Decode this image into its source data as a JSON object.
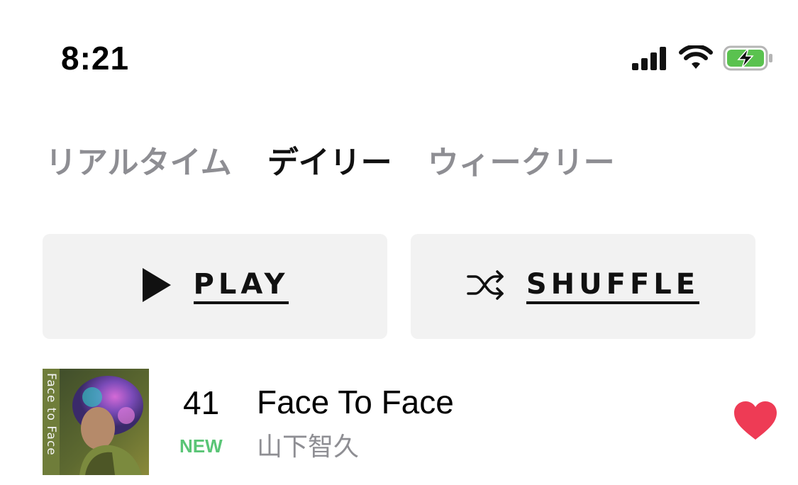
{
  "status_bar": {
    "time": "8:21",
    "icons": [
      "cellular-signal-icon",
      "wifi-icon",
      "battery-charging-icon"
    ],
    "battery_color": "#5ac24f"
  },
  "tabs": [
    {
      "label": "リアルタイム",
      "active": false
    },
    {
      "label": "デイリー",
      "active": true
    },
    {
      "label": "ウィークリー",
      "active": false
    }
  ],
  "actions": {
    "play_label": "PLAY",
    "play_icon": "play-icon",
    "shuffle_label": "SHUFFLE",
    "shuffle_icon": "shuffle-icon"
  },
  "tracks": [
    {
      "rank": "41",
      "badge": "NEW",
      "title": "Face To Face",
      "artist": "山下智久",
      "artwork_text": "Face to Face",
      "liked": true,
      "like_icon": "heart-icon"
    }
  ],
  "colors": {
    "accent_new": "#5ac576",
    "heart": "#ee3b55",
    "inactive_tab": "#8e8e93",
    "button_bg": "#f2f2f2"
  }
}
